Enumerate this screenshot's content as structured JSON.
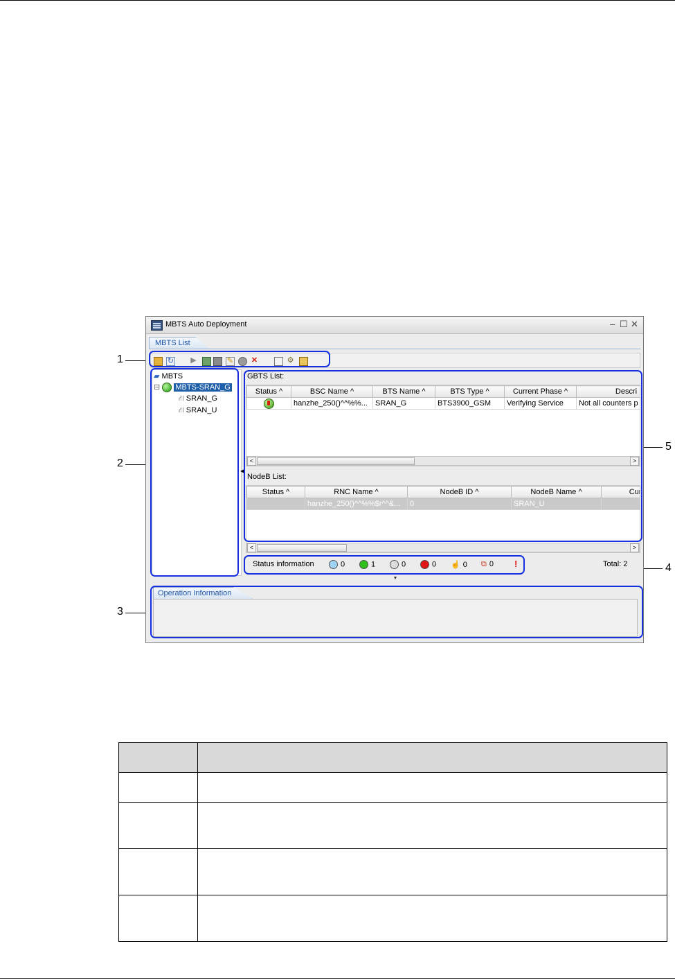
{
  "window": {
    "title": "MBTS Auto Deployment",
    "controls": {
      "minimize": "–",
      "maximize": "☐",
      "close": "✕"
    }
  },
  "tabs": {
    "mbts_list": "MBTS List",
    "operation_info": "Operation Information"
  },
  "tree": {
    "root": "MBTS",
    "node": "MBTS-SRAN_G",
    "children": [
      "SRAN_G",
      "SRAN_U"
    ]
  },
  "gbts": {
    "label": "GBTS List:",
    "columns": [
      "Status ^",
      "BSC Name ^",
      "BTS Name ^",
      "BTS Type ^",
      "Current Phase ^",
      "Descri"
    ],
    "rows": [
      {
        "bsc_name": "hanzhe_250()^^%%...",
        "bts_name": "SRAN_G",
        "bts_type": "BTS3900_GSM",
        "current_phase": "Verifying Service",
        "description": "Not all counters p"
      }
    ]
  },
  "nodeb": {
    "label": "NodeB List:",
    "columns": [
      "Status ^",
      "RNC Name ^",
      "NodeB ID ^",
      "NodeB Name ^",
      "Curre"
    ],
    "rows": [
      {
        "rnc_name": "hanzhe_250()^^%%$r^^&...",
        "nodeb_id": "0",
        "nodeb_name": "SRAN_U"
      }
    ]
  },
  "status_bar": {
    "label": "Status information",
    "counts": {
      "blue": "0",
      "green": "1",
      "grey": "0",
      "red": "0",
      "hand": "0",
      "conflict": "0"
    },
    "total": "Total: 2",
    "alert": "!"
  },
  "callouts": [
    "1",
    "2",
    "3",
    "4",
    "5"
  ],
  "colors": {
    "highlight": "#1430e0",
    "tab_text": "#1d56a8",
    "selection": "#1f5ea8"
  }
}
